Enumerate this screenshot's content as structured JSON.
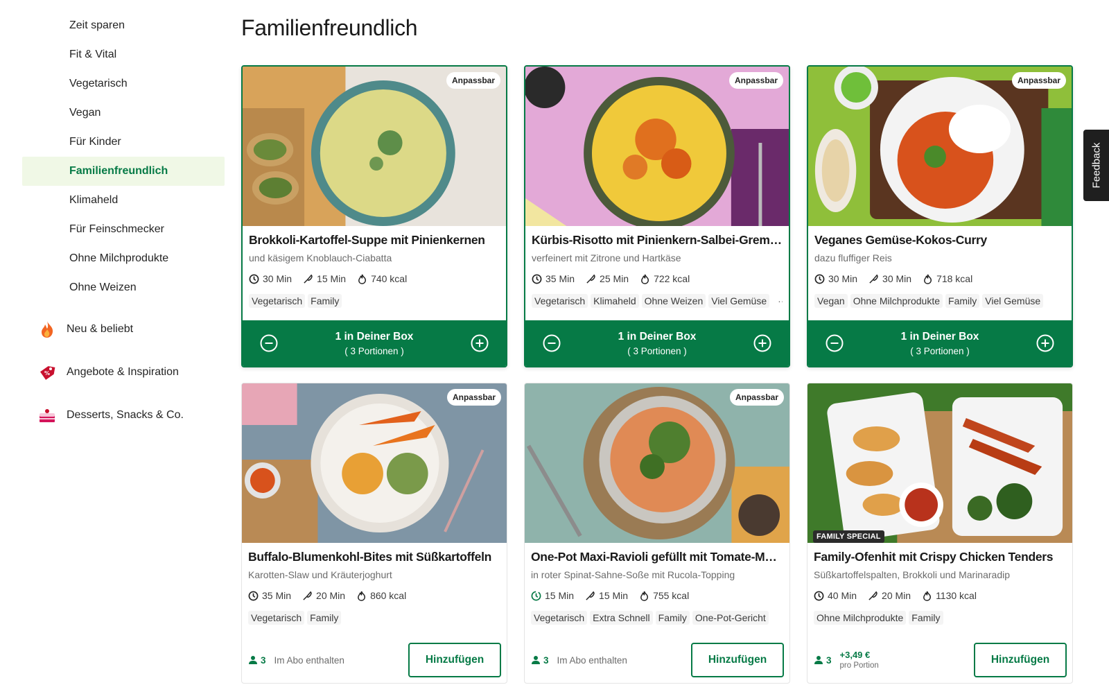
{
  "sidebar": {
    "items": [
      {
        "label": "Zeit sparen"
      },
      {
        "label": "Fit & Vital"
      },
      {
        "label": "Vegetarisch"
      },
      {
        "label": "Vegan"
      },
      {
        "label": "Für Kinder"
      },
      {
        "label": "Familienfreundlich",
        "active": true
      },
      {
        "label": "Klimaheld"
      },
      {
        "label": "Für Feinschmecker"
      },
      {
        "label": "Ohne Milchprodukte"
      },
      {
        "label": "Ohne Weizen"
      }
    ],
    "categories": [
      {
        "label": "Neu & beliebt",
        "icon": "flame-icon"
      },
      {
        "label": "Angebote & Inspiration",
        "icon": "price-tag-icon"
      },
      {
        "label": "Desserts, Snacks & Co.",
        "icon": "cake-icon"
      }
    ]
  },
  "page": {
    "title": "Familienfreundlich"
  },
  "common": {
    "badge_customizable": "Anpassbar",
    "box_title": "1 in Deiner Box",
    "box_portions": "( 3 Portionen )",
    "add_label": "Hinzufügen",
    "included_label": "Im Abo enthalten",
    "more": "···"
  },
  "recipes": [
    {
      "title": "Brokkoli-Kartoffel-Suppe mit Pinienkernen",
      "subtitle": "und käsigem Knoblauch-Ciabatta",
      "total_time": "30 Min",
      "prep_time": "15 Min",
      "calories": "740 kcal",
      "tags": [
        "Vegetarisch",
        "Family"
      ],
      "customizable": true,
      "in_box": true
    },
    {
      "title": "Kürbis-Risotto mit Pinienkern-Salbei-Gremola...",
      "subtitle": "verfeinert mit Zitrone und Hartkäse",
      "total_time": "35 Min",
      "prep_time": "25 Min",
      "calories": "722 kcal",
      "tags": [
        "Vegetarisch",
        "Klimaheld",
        "Ohne Weizen",
        "Viel Gemüse"
      ],
      "customizable": true,
      "in_box": true
    },
    {
      "title": "Veganes Gemüse-Kokos-Curry",
      "subtitle": "dazu fluffiger Reis",
      "total_time": "30 Min",
      "prep_time": "30 Min",
      "calories": "718 kcal",
      "tags": [
        "Vegan",
        "Ohne Milchprodukte",
        "Family",
        "Viel Gemüse"
      ],
      "customizable": true,
      "in_box": true
    },
    {
      "title": "Buffalo-Blumenkohl-Bites mit Süßkartoffeln",
      "subtitle": "Karotten-Slaw und Kräuterjoghurt",
      "total_time": "35 Min",
      "prep_time": "20 Min",
      "calories": "860 kcal",
      "tags": [
        "Vegetarisch",
        "Family"
      ],
      "customizable": true,
      "in_box": false,
      "portions": "3"
    },
    {
      "title": "One-Pot Maxi-Ravioli gefüllt mit Tomate-Moz...",
      "subtitle": "in roter Spinat-Sahne-Soße mit Rucola-Topping",
      "total_time": "15 Min",
      "prep_time": "15 Min",
      "calories": "755 kcal",
      "tags": [
        "Vegetarisch",
        "Extra Schnell",
        "Family",
        "One-Pot-Gericht"
      ],
      "customizable": true,
      "in_box": false,
      "portions": "3"
    },
    {
      "title": "Family-Ofenhit mit Crispy Chicken Tenders",
      "subtitle": "Süßkartoffelspalten, Brokkoli und Marinaradip",
      "total_time": "40 Min",
      "prep_time": "20 Min",
      "calories": "1130 kcal",
      "tags": [
        "Ohne Milchprodukte",
        "Family"
      ],
      "customizable": false,
      "in_box": false,
      "portions": "3",
      "special_badge": "FAMILY SPECIAL",
      "price": "+3,49 €",
      "price_unit": "pro Portion"
    }
  ],
  "feedback": {
    "label": "Feedback"
  },
  "colors": {
    "brand_green": "#067a46",
    "active_bg": "#f0f8e6"
  }
}
